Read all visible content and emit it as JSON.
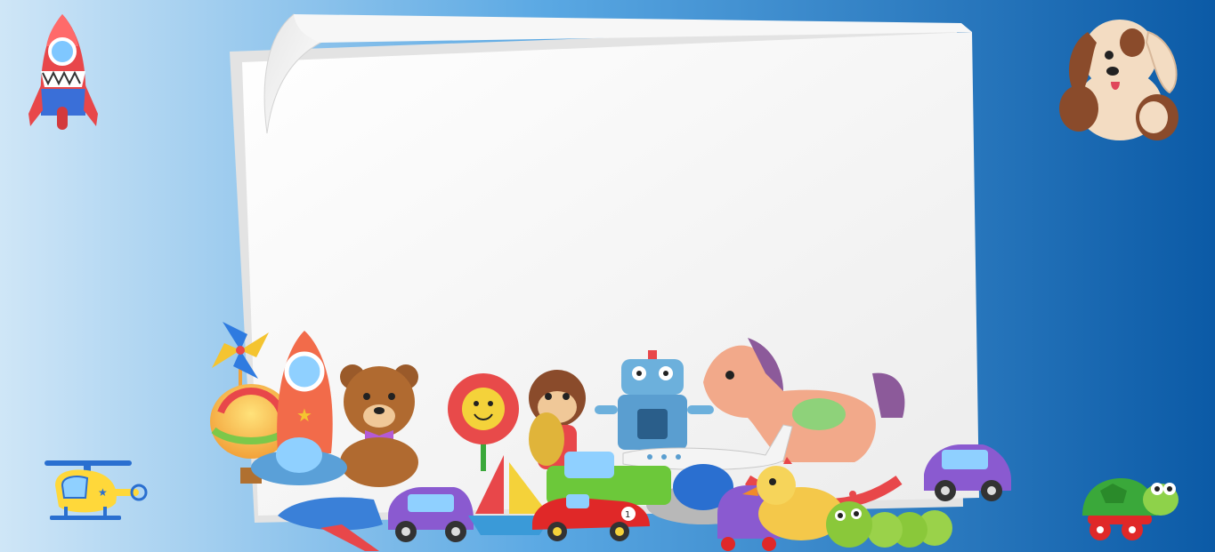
{
  "scene": {
    "background": {
      "gradient_from": "#cfe6f7",
      "gradient_mid": "#3a8ed4",
      "gradient_to": "#0b5aa6"
    },
    "paper": {
      "color": "#f4f4f4",
      "shadow": "#d9d9d9"
    },
    "race_car_number": "1",
    "toys": [
      "rocket",
      "plush-dog",
      "helicopter",
      "turtle",
      "pinwheel",
      "hot-air-balloon",
      "teddy-bear",
      "flower",
      "monkey-with-cymbals",
      "robot",
      "rocking-horse",
      "airplane",
      "ufo",
      "toy-car",
      "race-car",
      "sailboat",
      "duck",
      "caterpillar"
    ]
  }
}
